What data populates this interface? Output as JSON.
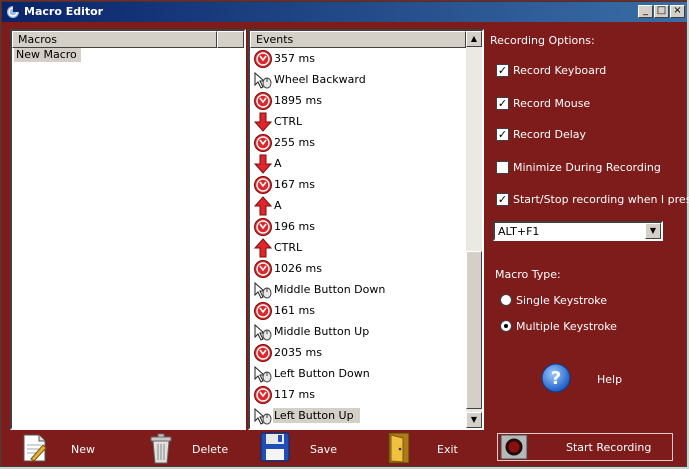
{
  "window": {
    "title": "Macro Editor",
    "controls": [
      "minimize",
      "maximize",
      "close"
    ]
  },
  "macros": {
    "header": "Macros",
    "items": [
      {
        "label": "New Macro",
        "selected": true
      }
    ]
  },
  "events": {
    "header": "Events",
    "items": [
      {
        "icon": "delay-icon",
        "label": "357 ms"
      },
      {
        "icon": "mouse-icon",
        "label": "Wheel Backward"
      },
      {
        "icon": "delay-icon",
        "label": "1895 ms"
      },
      {
        "icon": "arrow-down-icon",
        "label": "CTRL"
      },
      {
        "icon": "delay-icon",
        "label": "255 ms"
      },
      {
        "icon": "arrow-down-icon",
        "label": "A"
      },
      {
        "icon": "delay-icon",
        "label": "167 ms"
      },
      {
        "icon": "arrow-up-icon",
        "label": "A"
      },
      {
        "icon": "delay-icon",
        "label": "196 ms"
      },
      {
        "icon": "arrow-up-icon",
        "label": "CTRL"
      },
      {
        "icon": "delay-icon",
        "label": "1026 ms"
      },
      {
        "icon": "mouse-icon",
        "label": "Middle Button Down"
      },
      {
        "icon": "delay-icon",
        "label": "161 ms"
      },
      {
        "icon": "mouse-icon",
        "label": "Middle Button Up"
      },
      {
        "icon": "delay-icon",
        "label": "2035 ms"
      },
      {
        "icon": "mouse-icon",
        "label": "Left Button Down"
      },
      {
        "icon": "delay-icon",
        "label": "117 ms"
      },
      {
        "icon": "mouse-icon",
        "label": "Left Button Up",
        "selected": true
      }
    ]
  },
  "recording": {
    "heading": "Recording Options:",
    "record_keyboard": {
      "label": "Record Keyboard",
      "checked": true
    },
    "record_mouse": {
      "label": "Record Mouse",
      "checked": true
    },
    "record_delay": {
      "label": "Record Delay",
      "checked": true
    },
    "minimize": {
      "label": "Minimize During Recording",
      "checked": false
    },
    "start_stop": {
      "label": "Start/Stop recording when I press",
      "checked": true
    },
    "hotkey": "ALT+F1"
  },
  "macro_type": {
    "heading": "Macro Type:",
    "single": {
      "label": "Single Keystroke",
      "selected": false
    },
    "multiple": {
      "label": "Multiple Keystroke",
      "selected": true
    }
  },
  "help": {
    "label": "Help"
  },
  "toolbar": {
    "new": "New",
    "delete": "Delete",
    "save": "Save",
    "exit": "Exit",
    "start_recording": "Start Recording"
  },
  "colors": {
    "background": "#7e1b1b",
    "title_start": "#0a246a",
    "title_end": "#3a6ea5",
    "event_red": "#e0262b"
  }
}
